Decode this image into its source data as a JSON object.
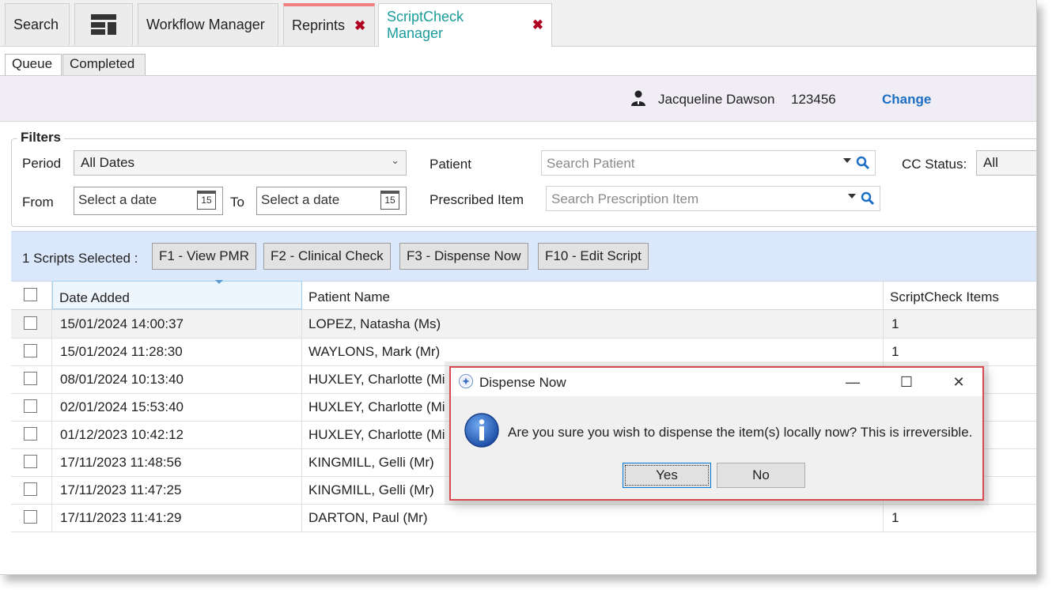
{
  "tabs": [
    {
      "label": "Search"
    },
    {
      "label": "Workflow Manager"
    },
    {
      "label": "Reprints",
      "closable": true
    },
    {
      "label": "ScriptCheck Manager",
      "closable": true,
      "active": true
    }
  ],
  "tab_close_glyph": "✖",
  "subtabs": [
    {
      "label": "Queue",
      "active": true
    },
    {
      "label": "Completed"
    }
  ],
  "user": {
    "name": "Jacqueline Dawson",
    "id": "123456",
    "change_label": "Change"
  },
  "filters": {
    "title": "Filters",
    "period_label": "Period",
    "period_value": "All Dates",
    "from_label": "From",
    "to_label": "To",
    "date_placeholder": "Select a date",
    "calendar_day": "15",
    "patient_label": "Patient",
    "patient_placeholder": "Search Patient",
    "prescribed_label": "Prescribed Item",
    "prescribed_placeholder": "Search Prescription Item",
    "cc_status_label": "CC Status:",
    "cc_status_value": "All"
  },
  "actions": {
    "selected_text": "1 Scripts Selected :",
    "buttons": [
      "F1 - View PMR",
      "F2 - Clinical Check",
      "F3 - Dispense Now",
      "F10 - Edit Script"
    ]
  },
  "grid": {
    "columns": [
      "Date Added",
      "Patient Name",
      "ScriptCheck Items"
    ],
    "rows": [
      {
        "date": "15/01/2024 14:00:37",
        "patient": "LOPEZ, Natasha (Ms)",
        "items": "1"
      },
      {
        "date": "15/01/2024 11:28:30",
        "patient": "WAYLONS, Mark (Mr)",
        "items": "1"
      },
      {
        "date": "08/01/2024 10:13:40",
        "patient": "HUXLEY, Charlotte (Mi",
        "items": ""
      },
      {
        "date": "02/01/2024 15:53:40",
        "patient": "HUXLEY, Charlotte (Mi",
        "items": ""
      },
      {
        "date": "01/12/2023 10:42:12",
        "patient": "HUXLEY, Charlotte (Mi",
        "items": ""
      },
      {
        "date": "17/11/2023 11:48:56",
        "patient": "KINGMILL, Gelli (Mr)",
        "items": ""
      },
      {
        "date": "17/11/2023 11:47:25",
        "patient": "KINGMILL, Gelli (Mr)",
        "items": ""
      },
      {
        "date": "17/11/2023 11:41:29",
        "patient": "DARTON, Paul (Mr)",
        "items": "1"
      }
    ]
  },
  "dialog": {
    "title": "Dispense Now",
    "message": "Are you sure you wish to dispense the item(s) locally now? This is irreversible.",
    "yes_label": "Yes",
    "no_label": "No",
    "minimize_glyph": "—",
    "maximize_glyph": "☐",
    "close_glyph": "✕"
  },
  "colors": {
    "accent_teal": "#1a9c9a",
    "link_blue": "#1c6fc4",
    "highlight_red": "#d9484f",
    "action_bar": "#dbe8fb"
  }
}
